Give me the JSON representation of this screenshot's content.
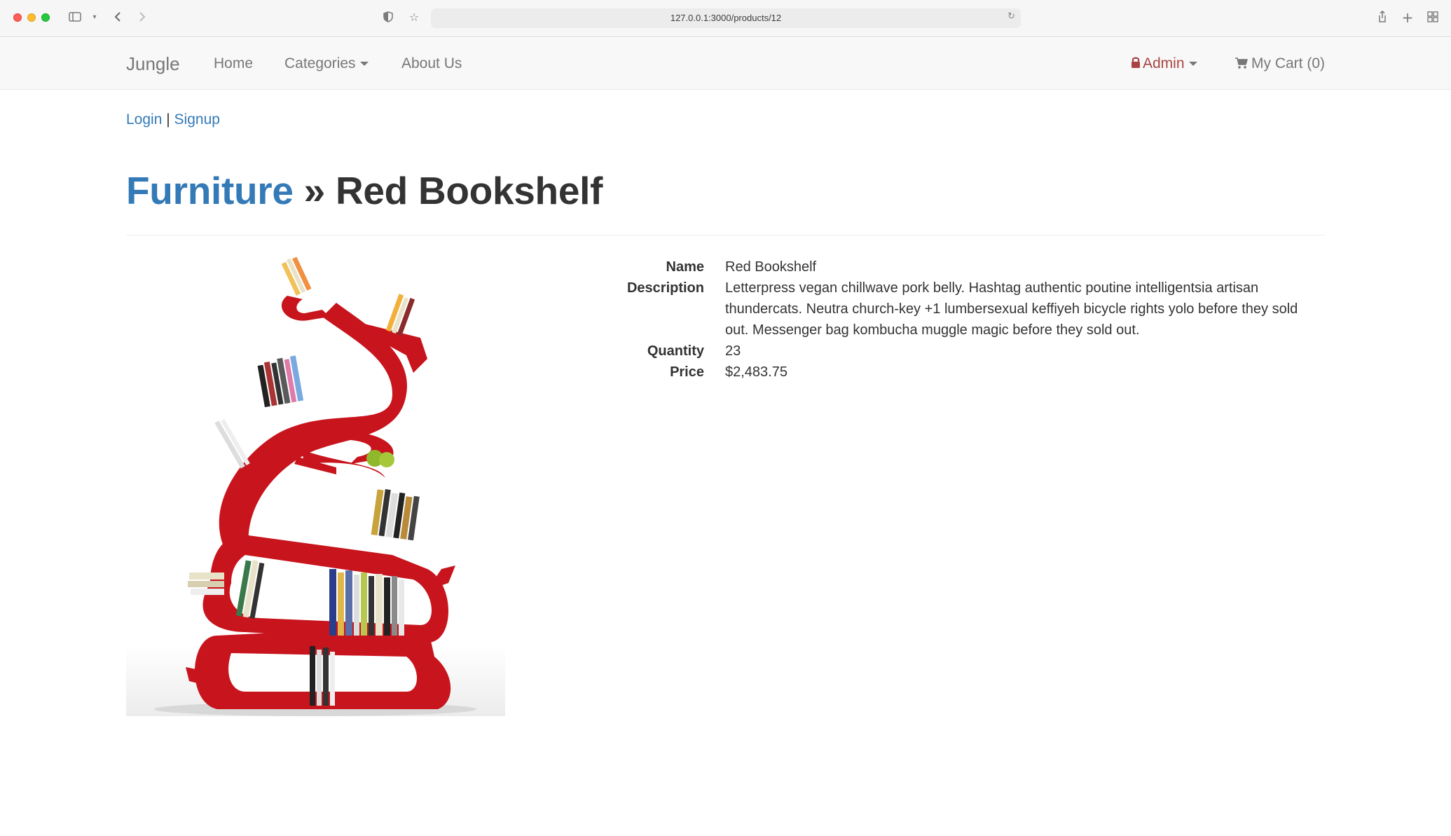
{
  "browser": {
    "url": "127.0.0.1:3000/products/12"
  },
  "navbar": {
    "brand": "Jungle",
    "links": {
      "home": "Home",
      "categories": "Categories",
      "about": "About Us"
    },
    "admin": "Admin",
    "cart": "My Cart (0)",
    "admin_color": "#a94442"
  },
  "auth": {
    "login": "Login",
    "separator": "|",
    "signup": "Signup"
  },
  "page": {
    "category": "Furniture",
    "separator": "»",
    "product_name": "Red Bookshelf"
  },
  "details": {
    "labels": {
      "name": "Name",
      "description": "Description",
      "quantity": "Quantity",
      "price": "Price"
    },
    "values": {
      "name": "Red Bookshelf",
      "description": "Letterpress vegan chillwave pork belly. Hashtag authentic poutine intelligentsia artisan thundercats. Neutra church-key +1 lumbersexual keffiyeh bicycle rights yolo before they sold out. Messenger bag kombucha muggle magic before they sold out.",
      "quantity": "23",
      "price": "$2,483.75"
    }
  },
  "colors": {
    "link": "#337ab7",
    "bookshelf": "#c8141c"
  }
}
